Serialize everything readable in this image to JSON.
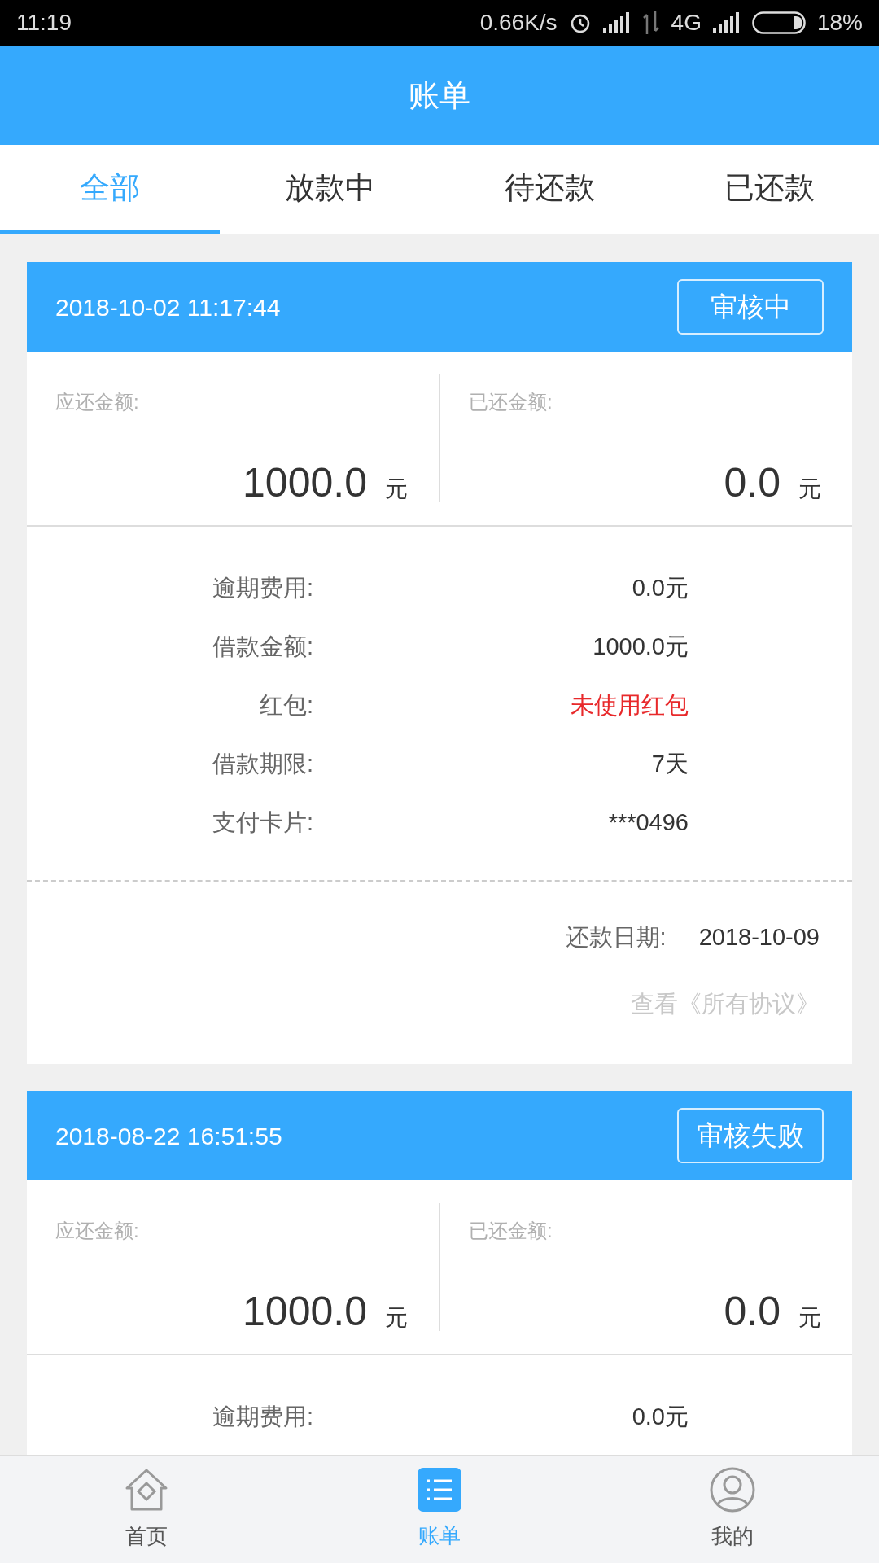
{
  "status_bar": {
    "time": "11:19",
    "speed": "0.66K/s",
    "network": "4G",
    "battery": "18%"
  },
  "header": {
    "title": "账单"
  },
  "tabs": [
    {
      "label": "全部",
      "selected": true
    },
    {
      "label": "放款中",
      "selected": false
    },
    {
      "label": "待还款",
      "selected": false
    },
    {
      "label": "已还款",
      "selected": false
    }
  ],
  "bills": [
    {
      "time": "2018-10-02 11:17:44",
      "status": "审核中",
      "due_label": "应还金额:",
      "due_amount": "1000.0",
      "due_unit": "元",
      "paid_label": "已还金额:",
      "paid_amount": "0.0",
      "paid_unit": "元",
      "details": [
        {
          "label": "逾期费用:",
          "value": "0.0元",
          "kind": "plain"
        },
        {
          "label": "借款金额:",
          "value": "1000.0元",
          "kind": "plain"
        },
        {
          "label": "红包:",
          "value": "未使用红包",
          "kind": "alert"
        },
        {
          "label": "借款期限:",
          "value": "7天",
          "kind": "plain"
        },
        {
          "label": "支付卡片:",
          "value": "***0496",
          "kind": "plain"
        }
      ],
      "repay_label": "还款日期:",
      "repay_date": "2018-10-09",
      "agreement_link": "查看《所有协议》"
    },
    {
      "time": "2018-08-22 16:51:55",
      "status": "审核失败",
      "due_label": "应还金额:",
      "due_amount": "1000.0",
      "due_unit": "元",
      "paid_label": "已还金额:",
      "paid_amount": "0.0",
      "paid_unit": "元",
      "details": [
        {
          "label": "逾期费用:",
          "value": "0.0元",
          "kind": "plain"
        }
      ]
    }
  ],
  "nav": [
    {
      "label": "首页",
      "kind": "home",
      "selected": false
    },
    {
      "label": "账单",
      "kind": "list",
      "selected": true
    },
    {
      "label": "我的",
      "kind": "user",
      "selected": false
    }
  ]
}
